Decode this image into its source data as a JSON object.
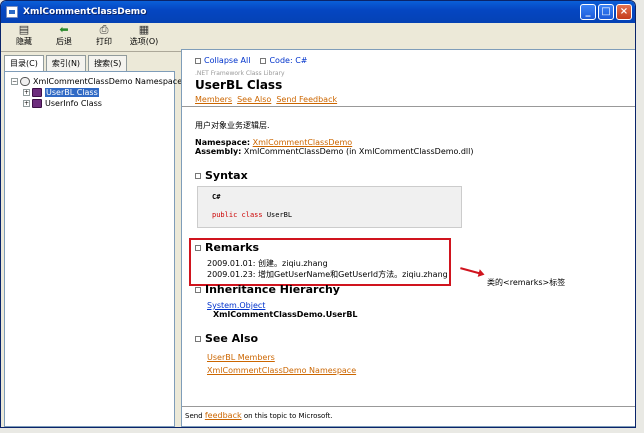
{
  "window": {
    "title": "XmlCommentClassDemo"
  },
  "toolbar": {
    "items": [
      {
        "label": "隐藏"
      },
      {
        "label": "后退"
      },
      {
        "label": "打印"
      },
      {
        "label": "选项(O)"
      }
    ]
  },
  "left": {
    "tabs": [
      "目录(C)",
      "索引(N)",
      "搜索(S)"
    ],
    "tree": {
      "root": "XmlCommentClassDemo Namespace",
      "children": [
        "UserBL Class",
        "UserInfo Class"
      ]
    }
  },
  "doc": {
    "collapse_all": "Collapse All",
    "code_label": "Code: C#",
    "subtitle": ".NET Framework Class Library",
    "title": "UserBL Class",
    "links": [
      "Members",
      "See Also",
      "Send Feedback"
    ],
    "intro": "用户对象业务逻辑层.",
    "namespace_label": "Namespace:",
    "namespace_value": "XmlCommentClassDemo",
    "assembly_label": "Assembly:",
    "assembly_value": "XmlCommentClassDemo (in XmlCommentClassDemo.dll)",
    "syntax_title": "Syntax",
    "code_lang": "C#",
    "code_kw1": "public",
    "code_kw2": "class",
    "code_name": "UserBL",
    "remarks_title": "Remarks",
    "remarks": [
      "2009.01.01: 创建。ziqiu.zhang",
      "2009.01.23: 增加GetUserName和GetUserId方法。ziqiu.zhang"
    ],
    "inheritance_title": "Inheritance Hierarchy",
    "inherit_base": "System.Object",
    "inherit_current": "XmlCommentClassDemo.UserBL",
    "seealso_title": "See Also",
    "seealso_links": [
      "UserBL Members",
      "XmlCommentClassDemo Namespace"
    ],
    "footer_pre": "Send ",
    "footer_link": "feedback",
    "footer_post": " on this topic to Microsoft."
  },
  "annotation": {
    "label": "类的<remarks>标签"
  }
}
